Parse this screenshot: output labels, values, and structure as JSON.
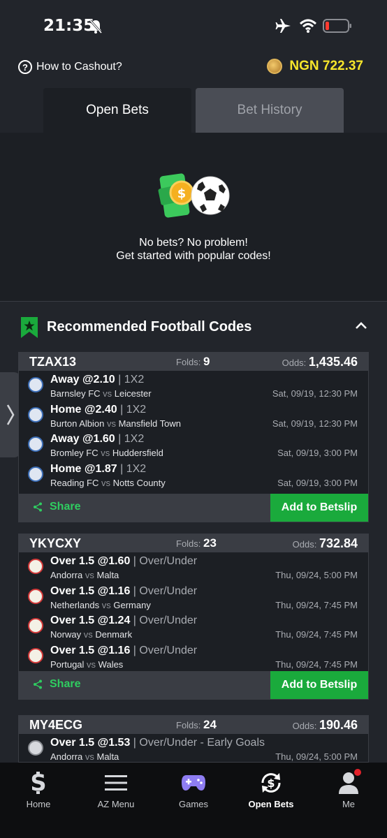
{
  "status": {
    "time": "21:35"
  },
  "header": {
    "cashout_label": "How to Cashout?",
    "balance": "NGN 722.37"
  },
  "tabs": [
    {
      "label": "Open Bets",
      "active": true
    },
    {
      "label": "Bet History",
      "active": false
    }
  ],
  "empty": {
    "line1": "No bets? No problem!",
    "line2": "Get started with popular codes!"
  },
  "recommended": {
    "title": "Recommended Football Codes",
    "cards": [
      {
        "code": "TZAX13",
        "folds_label": "Folds:",
        "folds": "9",
        "odds_label": "Odds:",
        "odds": "1,435.46",
        "selections": [
          {
            "pick": "Away @2.10",
            "market": "| 1X2",
            "home": "Barnsley FC",
            "vs": "vs",
            "away": "Leicester",
            "date": "Sat, 09/19, 12:30 PM"
          },
          {
            "pick": "Home @2.40",
            "market": "| 1X2",
            "home": "Burton Albion",
            "vs": "vs",
            "away": "Mansfield Town",
            "date": "Sat, 09/19, 12:30 PM"
          },
          {
            "pick": "Away @1.60",
            "market": "| 1X2",
            "home": "Bromley FC",
            "vs": "vs",
            "away": "Huddersfield",
            "date": "Sat, 09/19, 3:00 PM"
          },
          {
            "pick": "Home @1.87",
            "market": "| 1X2",
            "home": "Reading FC",
            "vs": "vs",
            "away": "Notts County",
            "date": "Sat, 09/19, 3:00 PM"
          }
        ],
        "share_label": "Share",
        "betslip_label": "Add to Betslip"
      },
      {
        "code": "YKYCXY",
        "folds_label": "Folds:",
        "folds": "23",
        "odds_label": "Odds:",
        "odds": "732.84",
        "selections": [
          {
            "pick": "Over 1.5 @1.60",
            "market": "| Over/Under",
            "home": "Andorra",
            "vs": "vs",
            "away": "Malta",
            "date": "Thu, 09/24, 5:00 PM"
          },
          {
            "pick": "Over 1.5 @1.16",
            "market": "| Over/Under",
            "home": "Netherlands",
            "vs": "vs",
            "away": "Germany",
            "date": "Thu, 09/24, 7:45 PM"
          },
          {
            "pick": "Over 1.5 @1.24",
            "market": "| Over/Under",
            "home": "Norway",
            "vs": "vs",
            "away": "Denmark",
            "date": "Thu, 09/24, 7:45 PM"
          },
          {
            "pick": "Over 1.5 @1.16",
            "market": "| Over/Under",
            "home": "Portugal",
            "vs": "vs",
            "away": "Wales",
            "date": "Thu, 09/24, 7:45 PM"
          }
        ],
        "share_label": "Share",
        "betslip_label": "Add to Betslip"
      },
      {
        "code": "MY4ECG",
        "folds_label": "Folds:",
        "folds": "24",
        "odds_label": "Odds:",
        "odds": "190.46",
        "selections": [
          {
            "pick": "Over 1.5 @1.53",
            "market": "| Over/Under - Early Goals",
            "home": "Andorra",
            "vs": "vs",
            "away": "Malta",
            "date": "Thu, 09/24, 5:00 PM"
          }
        ]
      }
    ]
  },
  "nav": [
    {
      "label": "Home",
      "icon": "sporty-logo-icon"
    },
    {
      "label": "AZ Menu",
      "icon": "hamburger-menu-icon"
    },
    {
      "label": "Games",
      "icon": "gamepad-icon"
    },
    {
      "label": "Open Bets",
      "icon": "open-bets-icon",
      "active": true
    },
    {
      "label": "Me",
      "icon": "user-icon"
    }
  ],
  "colors": {
    "accent_green": "#1aaa3c",
    "share_green": "#2fcd60",
    "balance_yellow": "#f7e62b"
  }
}
